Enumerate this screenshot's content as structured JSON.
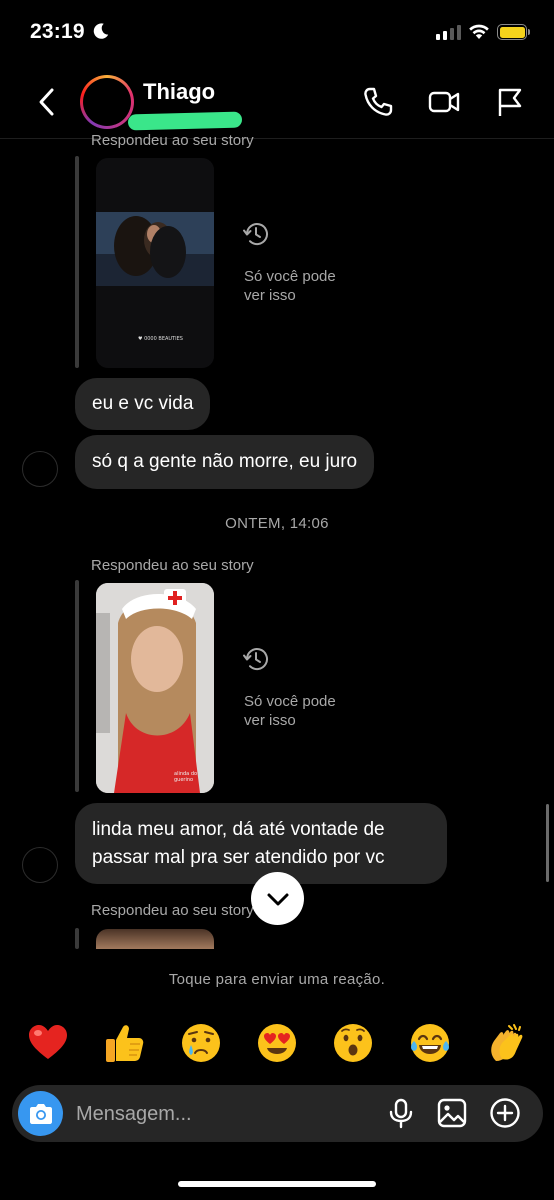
{
  "status_bar": {
    "time": "23:19",
    "battery_level": 1.0,
    "battery_color": "#f5d31c",
    "signal_bars_active": 2,
    "focus_icon": "moon-icon"
  },
  "header": {
    "contact_name": "Thiago",
    "icons": [
      "back-arrow-icon",
      "phone-icon",
      "video-camera-icon",
      "flag-icon"
    ],
    "avatar_ring_colors": [
      "#f9b13b",
      "#e1306c",
      "#833ab4"
    ]
  },
  "conversation": {
    "story_reply_label": "Respondeu ao seu story",
    "only_you_line1": "Só você pode",
    "only_you_line2": "ver isso",
    "story_caption_1": "♥ 0000 BEAUTIES",
    "story_caption_2": "alinda do guerino",
    "messages": [
      {
        "text": "eu e vc vida"
      },
      {
        "text": "só q a gente não morre, eu juro"
      }
    ],
    "timestamp": "ONTEM, 14:06",
    "message_multi": {
      "line1": "linda meu amor, dá até vontade de",
      "line2": "passar mal pra ser atendido por vc"
    }
  },
  "reactions": {
    "hint": "Toque para enviar uma reação.",
    "emojis": [
      "red-heart",
      "thumbs-up",
      "crying-face",
      "heart-eyes",
      "surprised-face",
      "tears-of-joy",
      "clapping-hands"
    ]
  },
  "composer": {
    "placeholder": "Mensagem...",
    "accent": "#3797f0",
    "icons": [
      "camera-icon",
      "microphone-icon",
      "gallery-icon",
      "plus-circle-icon"
    ]
  }
}
